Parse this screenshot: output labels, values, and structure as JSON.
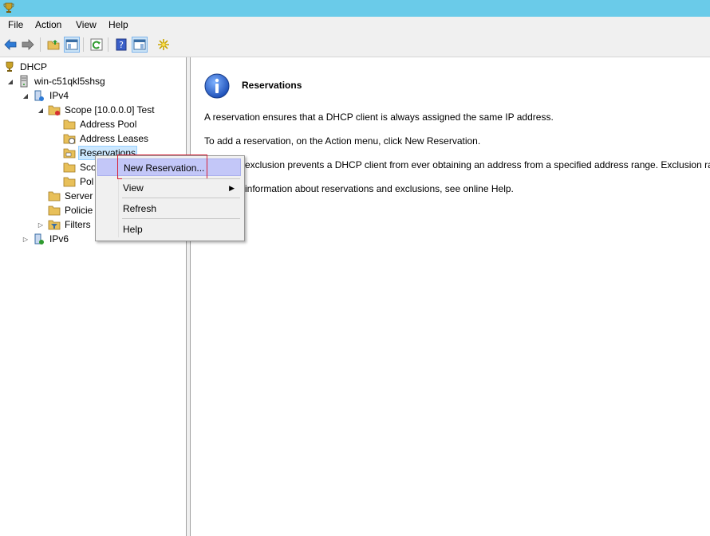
{
  "window": {
    "app_icon": "dhcp-trophy-icon",
    "title_bar_color": "#6acbe9"
  },
  "menu": {
    "items": [
      {
        "label": "File"
      },
      {
        "label": "Action"
      },
      {
        "label": "View"
      },
      {
        "label": "Help"
      }
    ]
  },
  "toolbar": {
    "buttons": [
      "back-arrow-icon",
      "forward-arrow-icon",
      "up-folder-icon",
      "show-hide-console-tree-icon",
      "refresh-icon",
      "help-icon",
      "action-pane-icon",
      "new-star-icon"
    ]
  },
  "tree": {
    "nodes": [
      {
        "label": "DHCP"
      },
      {
        "label": "win-c51qkl5shsg"
      },
      {
        "label": "IPv4"
      },
      {
        "label": "Scope [10.0.0.0] Test"
      },
      {
        "label": "Address Pool"
      },
      {
        "label": "Address Leases"
      },
      {
        "label": "Reservations"
      },
      {
        "label": "Sco"
      },
      {
        "label": "Pol"
      },
      {
        "label": "Server"
      },
      {
        "label": "Policie"
      },
      {
        "label": "Filters"
      },
      {
        "label": "IPv6"
      }
    ]
  },
  "content": {
    "heading": "Reservations",
    "paragraphs": [
      "A reservation ensures that a DHCP client is always assigned the same IP address.",
      "To add a reservation, on the Action menu, click New Reservation.",
      "exclusion prevents a DHCP client from ever obtaining an address from a specified address range.  Exclusion rang",
      "information about reservations and exclusions, see online Help."
    ]
  },
  "context_menu": {
    "items": [
      {
        "label": "New Reservation..."
      },
      {
        "label": "View"
      },
      {
        "label": "Refresh"
      },
      {
        "label": "Help"
      }
    ],
    "highlight_color": "#c3c7f8",
    "outline_color": "#d6233a"
  }
}
